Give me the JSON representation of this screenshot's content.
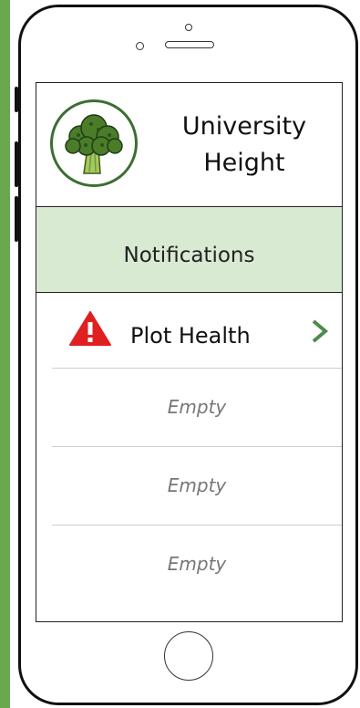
{
  "header": {
    "title_line1": "University",
    "title_line2": "Height",
    "logo_icon": "broccoli-icon"
  },
  "notifications": {
    "title": "Notifications"
  },
  "list": {
    "items": [
      {
        "label": "Plot Health",
        "icon": "warning-icon",
        "chevron": "chevron-right-icon"
      },
      {
        "label": "Empty"
      },
      {
        "label": "Empty"
      },
      {
        "label": "Empty"
      }
    ]
  },
  "colors": {
    "background": "#6aa84f",
    "notif_bar": "#d9ead3",
    "warning": "#e02020",
    "chevron": "#4f8b4a",
    "logo_ring": "#3c6e32"
  }
}
